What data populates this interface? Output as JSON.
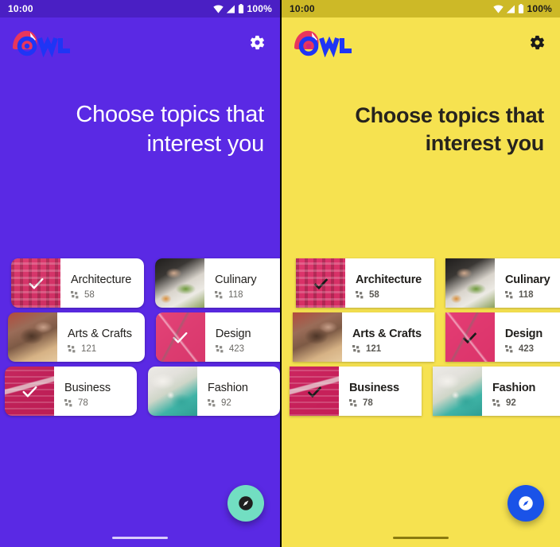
{
  "comparison": {
    "panels": [
      {
        "id": "baseline-purple-theme",
        "theme_name": "purple",
        "colors": {
          "background": "#5A29E4",
          "statusbar": "#4A1FC4",
          "statusbar_text": "#FFFFFF",
          "headline_text": "#FFFFFF",
          "fab": "#72DEC2",
          "fab_icon": "#1F1F1F",
          "card_surface": "#FFFFFF",
          "selection_overlay": "#E91E63",
          "checkmark": "#FFFFFF",
          "home_indicator": "#D9CCFA"
        },
        "statusbar": {
          "time": "10:00",
          "battery_percent": "100%",
          "icons": [
            "wifi-icon",
            "cellular-signal-icon",
            "battery-icon"
          ]
        },
        "appbar": {
          "logo_text": "OWL",
          "logo_icon": "owl-logo-icon",
          "settings_icon": "gear-icon"
        },
        "headline": "Choose topics that interest you",
        "topics": [
          [
            {
              "name": "Architecture",
              "count": "58",
              "selected": true,
              "thumb": "ph-arch",
              "count_icon": "grid-icon"
            },
            {
              "name": "Culinary",
              "count": "118",
              "selected": false,
              "thumb": "ph-culinary",
              "count_icon": "grid-icon"
            }
          ],
          [
            {
              "name": "Arts & Crafts",
              "count": "121",
              "selected": false,
              "thumb": "ph-crafts",
              "count_icon": "grid-icon"
            },
            {
              "name": "Design",
              "count": "423",
              "selected": true,
              "thumb": "ph-design",
              "count_icon": "grid-icon"
            }
          ],
          [
            {
              "name": "Business",
              "count": "78",
              "selected": true,
              "thumb": "ph-business",
              "count_icon": "grid-icon"
            },
            {
              "name": "Fashion",
              "count": "92",
              "selected": false,
              "thumb": "ph-fashion",
              "count_icon": "grid-icon"
            }
          ]
        ],
        "fab": {
          "icon": "compass-explore-icon"
        }
      },
      {
        "id": "custom-yellow-theme",
        "theme_name": "yellow",
        "colors": {
          "background": "#F6E250",
          "statusbar": "#CDB927",
          "statusbar_text": "#1A1A1A",
          "headline_text": "#26231E",
          "fab": "#1A53E8",
          "fab_icon": "#FFFFFF",
          "card_surface": "#FFFFFF",
          "selection_overlay": "#E91E63",
          "checkmark": "#1A1A1A",
          "home_indicator": "#8A7A10"
        },
        "statusbar": {
          "time": "10:00",
          "battery_percent": "100%",
          "icons": [
            "wifi-icon",
            "cellular-signal-icon",
            "battery-icon"
          ]
        },
        "appbar": {
          "logo_text": "OWL",
          "logo_icon": "owl-logo-icon",
          "settings_icon": "gear-icon"
        },
        "headline": "Choose topics that interest you",
        "topics": [
          [
            {
              "name": "Architecture",
              "count": "58",
              "selected": true,
              "thumb": "ph-arch",
              "count_icon": "grid-icon"
            },
            {
              "name": "Culinary",
              "count": "118",
              "selected": false,
              "thumb": "ph-culinary",
              "count_icon": "grid-icon"
            }
          ],
          [
            {
              "name": "Arts & Crafts",
              "count": "121",
              "selected": false,
              "thumb": "ph-crafts",
              "count_icon": "grid-icon"
            },
            {
              "name": "Design",
              "count": "423",
              "selected": true,
              "thumb": "ph-design",
              "count_icon": "grid-icon"
            }
          ],
          [
            {
              "name": "Business",
              "count": "78",
              "selected": true,
              "thumb": "ph-business",
              "count_icon": "grid-icon"
            },
            {
              "name": "Fashion",
              "count": "92",
              "selected": false,
              "thumb": "ph-fashion",
              "count_icon": "grid-icon"
            }
          ]
        ],
        "fab": {
          "icon": "compass-explore-icon"
        }
      }
    ]
  }
}
